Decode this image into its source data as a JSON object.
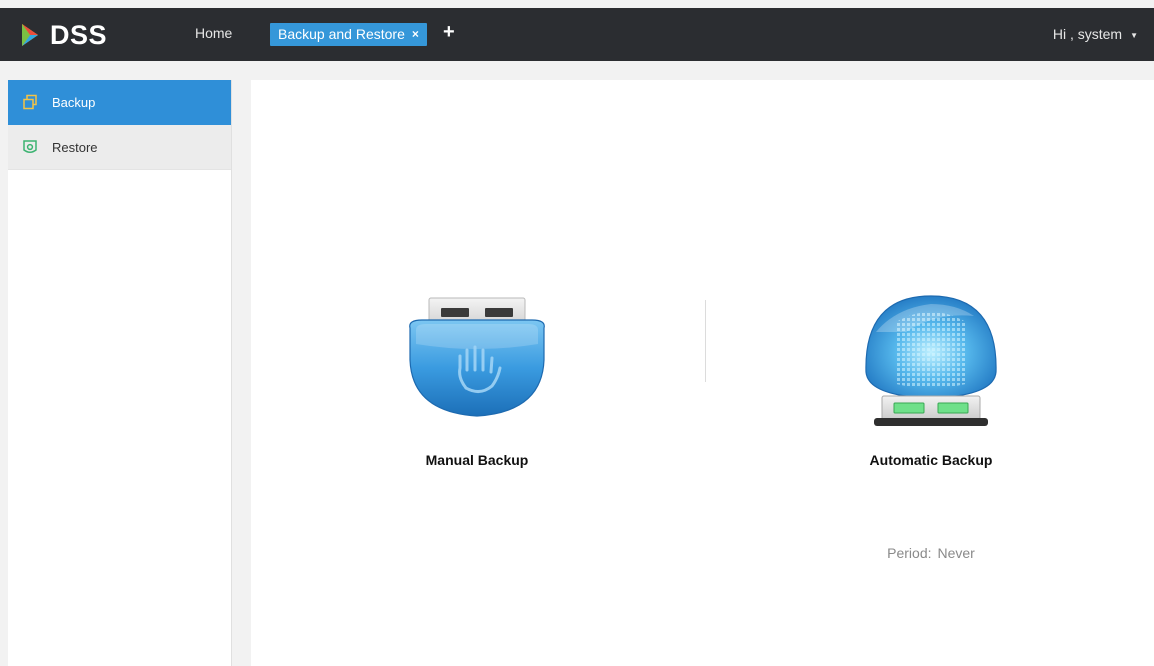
{
  "header": {
    "logo_text": "DSS",
    "home_label": "Home",
    "active_tab_label": "Backup and Restore",
    "tab_close_glyph": "×",
    "add_tab_glyph": "+",
    "user_greeting": "Hi , system",
    "user_caret_glyph": "▼"
  },
  "sidebar": {
    "items": [
      {
        "label": "Backup",
        "icon": "backup-icon",
        "active": true
      },
      {
        "label": "Restore",
        "icon": "restore-icon",
        "active": false
      }
    ]
  },
  "main": {
    "manual_backup": {
      "label": "Manual Backup",
      "icon": "manual-backup-icon"
    },
    "automatic_backup": {
      "label": "Automatic Backup",
      "icon": "automatic-backup-icon"
    },
    "period": {
      "label": "Period:",
      "value": "Never"
    }
  },
  "colors": {
    "topbar": "#2b2d31",
    "accent": "#3597d9",
    "sidebar_active": "#2f8fd8",
    "restore_icon": "#3cb371"
  }
}
